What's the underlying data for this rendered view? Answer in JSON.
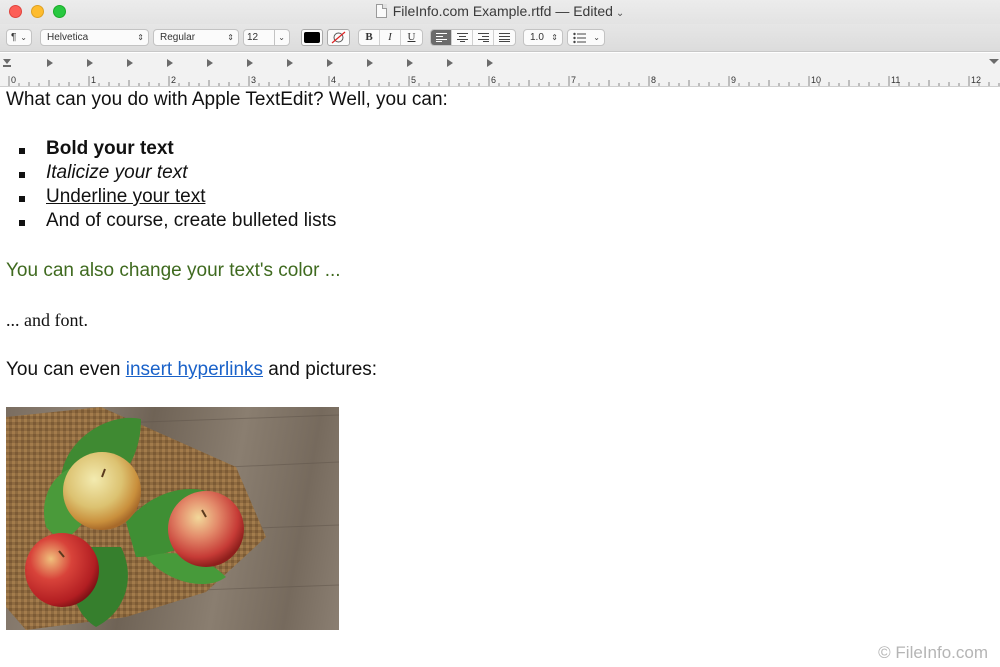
{
  "window": {
    "title": "FileInfo.com Example.rtfd — Edited",
    "title_menu_icon": "chevron-down-icon",
    "buttons": [
      "close",
      "minimize",
      "zoom"
    ]
  },
  "toolbar": {
    "paragraph_styles_label": "¶",
    "font_family": "Helvetica",
    "typeface": "Regular",
    "font_size": "12",
    "text_color": "#000000",
    "bold_label": "B",
    "italic_label": "I",
    "underline_label": "U",
    "alignment_selected": "left",
    "line_spacing": "1.0",
    "list_icon": "list-icon"
  },
  "ruler": {
    "numbers": [
      "0",
      "1",
      "2",
      "3",
      "4",
      "5",
      "6",
      "7",
      "8",
      "9",
      "10",
      "11",
      "12"
    ]
  },
  "document": {
    "intro": "What can you do with Apple TextEdit? Well, you can:",
    "bullets": [
      "Bold your text",
      "Italicize your text",
      "Underline your text",
      "And of course, create bulleted lists"
    ],
    "color_line": "You can also change your text's color ...",
    "color_line_color": "#3f6a1f",
    "font_line": "... and font.",
    "hyperlink_prefix": "You can even ",
    "hyperlink_text": "insert hyperlinks",
    "hyperlink_suffix": " and pictures:",
    "link_color": "#1a62c9"
  },
  "watermark": "© FileInfo.com"
}
